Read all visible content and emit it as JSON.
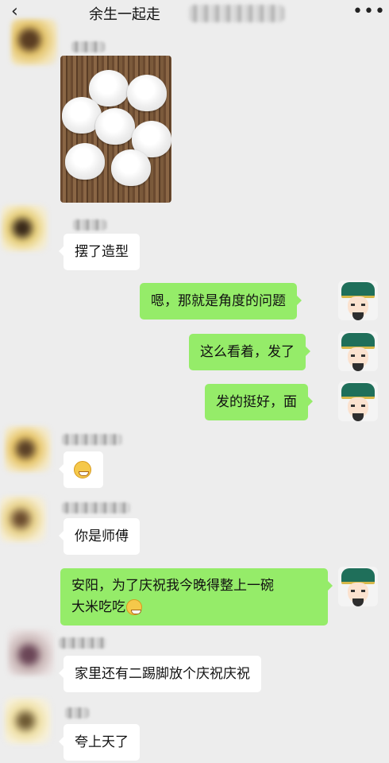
{
  "header": {
    "back_icon": "chevron-left-icon",
    "title": "余生一起走",
    "more_icon": "more-icon"
  },
  "messages": [
    {
      "side": "left",
      "type": "image",
      "content": "steamed-buns-photo"
    },
    {
      "side": "left",
      "type": "text",
      "text": "摆了造型"
    },
    {
      "side": "right",
      "type": "text",
      "text": "嗯，那就是角度的问题"
    },
    {
      "side": "right",
      "type": "text",
      "text": "这么看着，发了"
    },
    {
      "side": "right",
      "type": "text",
      "text": "发的挺好，面"
    },
    {
      "side": "left",
      "type": "emoji",
      "emoji": "grin-emoji"
    },
    {
      "side": "left",
      "type": "text",
      "text": "你是师傅"
    },
    {
      "side": "right",
      "type": "text",
      "line1": "安阳，为了庆祝我今晚得整上一碗",
      "line2": "大米吃吃",
      "emoji": "laugh-emoji"
    },
    {
      "side": "left",
      "type": "text",
      "text": "家里还有二踢脚放个庆祝庆祝"
    },
    {
      "side": "left",
      "type": "text",
      "text": "夸上天了"
    }
  ],
  "colors": {
    "background": "#ededed",
    "outgoing_bubble": "#95ec69",
    "incoming_bubble": "#ffffff"
  }
}
